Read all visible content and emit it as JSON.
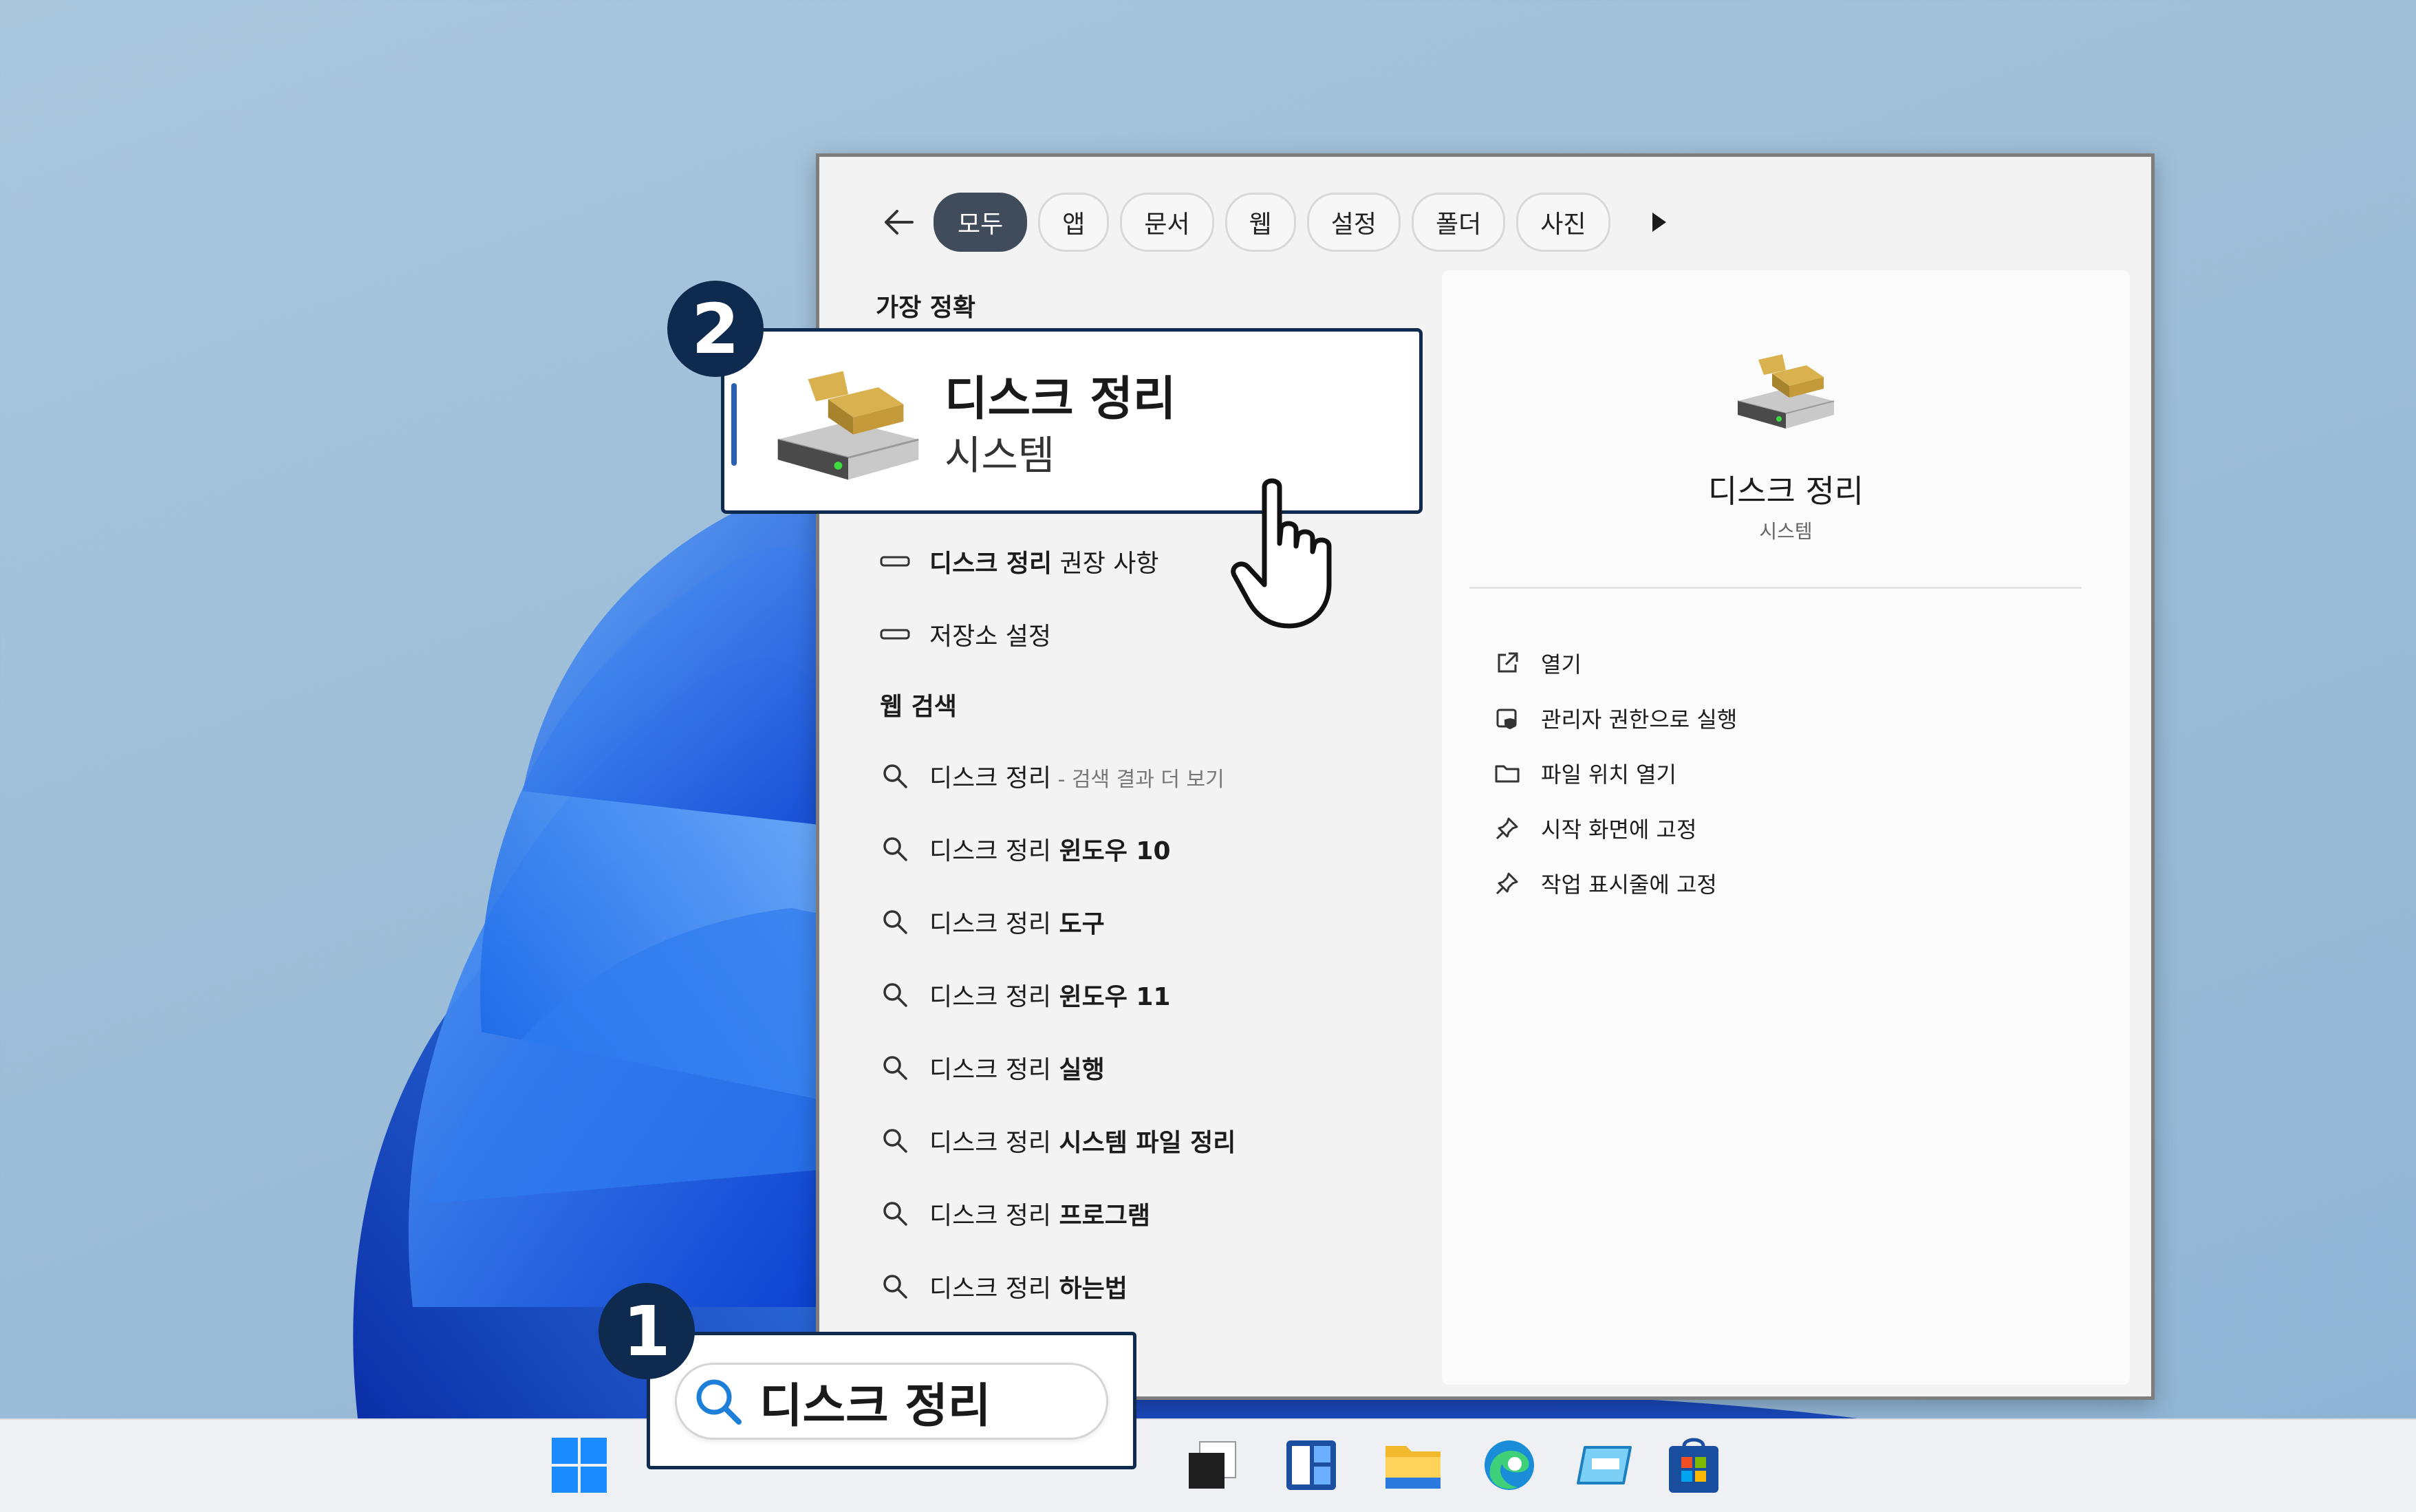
{
  "filters": {
    "tabs": [
      "모두",
      "앱",
      "문서",
      "웹",
      "설정",
      "폴더",
      "사진"
    ],
    "active_index": 0
  },
  "best_match": {
    "section_title": "가장 정확",
    "title": "디스크 정리",
    "subtitle": "시스템",
    "step_number": "2"
  },
  "settings_results": [
    {
      "bold": "디스크 정리",
      "rest": " 권장 사항"
    },
    {
      "bold": "",
      "rest": "저장소 설정"
    }
  ],
  "web_search": {
    "section_title": "웹 검색",
    "items": [
      {
        "prefix": "디스크 정리",
        "bold": "",
        "sub": " - 검색 결과 더 보기"
      },
      {
        "prefix": "디스크 정리 ",
        "bold": "윈도우 10",
        "sub": ""
      },
      {
        "prefix": "디스크 정리 ",
        "bold": "도구",
        "sub": ""
      },
      {
        "prefix": "디스크 정리 ",
        "bold": "윈도우 11",
        "sub": ""
      },
      {
        "prefix": "디스크 정리 ",
        "bold": "실행",
        "sub": ""
      },
      {
        "prefix": "디스크 정리 ",
        "bold": "시스템 파일 정리",
        "sub": ""
      },
      {
        "prefix": "디스크 정리 ",
        "bold": "프로그램",
        "sub": ""
      },
      {
        "prefix": "디스크 정리 ",
        "bold": "하는법",
        "sub": ""
      }
    ]
  },
  "detail": {
    "name": "디스크 정리",
    "type": "시스템",
    "actions": [
      "열기",
      "관리자 권한으로 실행",
      "파일 위치 열기",
      "시작 화면에 고정",
      "작업 표시줄에 고정"
    ]
  },
  "taskbar_search": {
    "query": "디스크 정리",
    "step_number": "1"
  },
  "colors": {
    "accent_dark": "#0e2a4e",
    "active_chip": "#404c5c",
    "selection_bar": "#2a5fb3"
  }
}
